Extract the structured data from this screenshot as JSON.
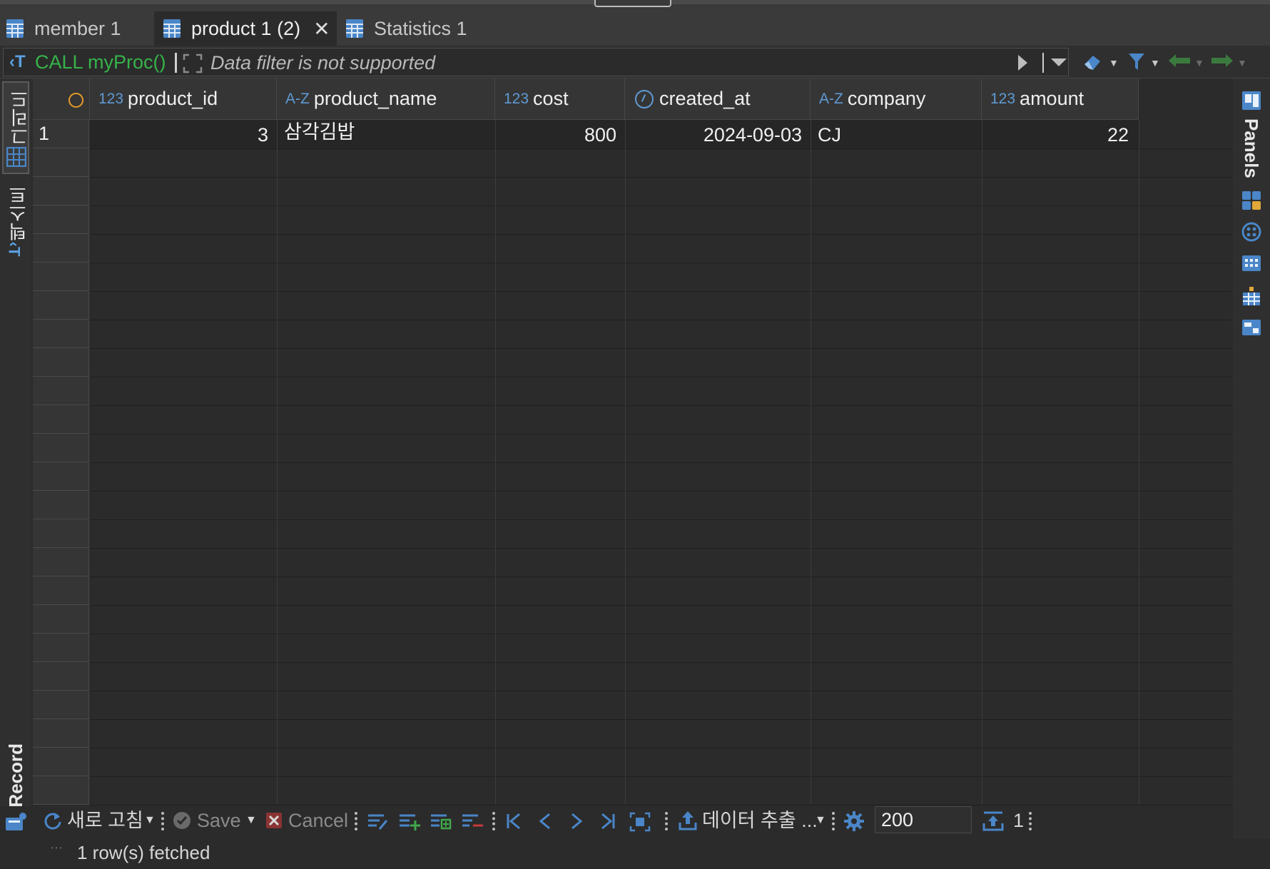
{
  "tabs": [
    {
      "label": "member 1",
      "active": false
    },
    {
      "label": "product 1 (2)",
      "active": true
    },
    {
      "label": "Statistics 1",
      "active": false
    }
  ],
  "filter": {
    "query": "CALL myProc()",
    "placeholder": "Data filter is not supported"
  },
  "left_panel": {
    "grid_label": "그리드",
    "text_label": "텍스트",
    "record_label": "Record"
  },
  "right_panel": {
    "panels_label": "Panels"
  },
  "columns": [
    {
      "type": "123",
      "name": "product_id"
    },
    {
      "type": "A-Z",
      "name": "product_name"
    },
    {
      "type": "123",
      "name": "cost"
    },
    {
      "type": "clock",
      "name": "created_at"
    },
    {
      "type": "A-Z",
      "name": "company"
    },
    {
      "type": "123",
      "name": "amount"
    }
  ],
  "rows": [
    {
      "num": "1",
      "product_id": "3",
      "product_name": "삼각김밥",
      "cost": "800",
      "created_at": "2024-09-03",
      "company": "CJ",
      "amount": "22"
    }
  ],
  "toolbar": {
    "refresh_label": "새로 고침",
    "save_label": "Save",
    "cancel_label": "Cancel",
    "export_label": "데이터 추출 ...",
    "fetch_size": "200",
    "row_count": "1"
  },
  "status": {
    "text": "1 row(s) fetched"
  },
  "colors": {
    "accent_blue": "#5f9ad4",
    "query_green": "#36b34a",
    "orange": "#e49a2a"
  }
}
